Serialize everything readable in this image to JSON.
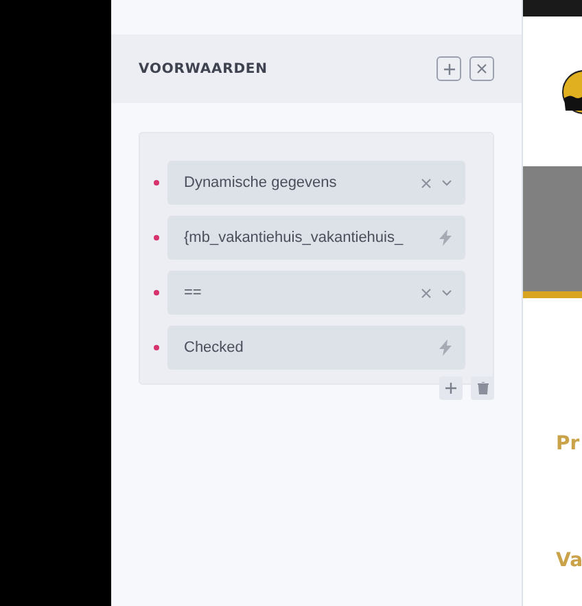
{
  "panel": {
    "title": "VOORWAARDEN"
  },
  "conditions": [
    {
      "kind": "select",
      "value": "Dynamische gegevens"
    },
    {
      "kind": "dynamic",
      "value": "{mb_vakantiehuis_vakantiehuis_"
    },
    {
      "kind": "select",
      "value": "=="
    },
    {
      "kind": "dynamic",
      "value": "Checked"
    }
  ],
  "preview": {
    "texts": [
      "Pr",
      "Va"
    ]
  }
}
